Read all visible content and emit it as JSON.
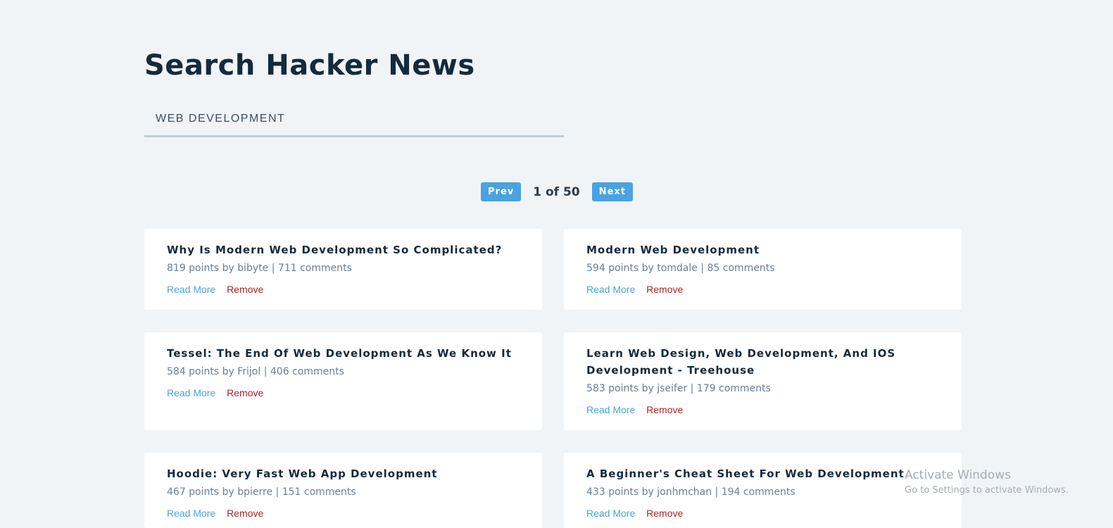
{
  "header": {
    "title": "Search Hacker News"
  },
  "search": {
    "value": "web development",
    "placeholder": ""
  },
  "pagination": {
    "prev_label": "Prev",
    "next_label": "Next",
    "status": "1 of 50"
  },
  "stories": [
    {
      "title": "Why Is Modern Web Development So Complicated?",
      "meta": "819 points by bibyte | 711 comments",
      "read_more": "Read More",
      "remove": "Remove"
    },
    {
      "title": "Modern Web Development",
      "meta": "594 points by tomdale | 85 comments",
      "read_more": "Read More",
      "remove": "Remove"
    },
    {
      "title": "Tessel: The End Of Web Development As We Know It",
      "meta": "584 points by Frijol | 406 comments",
      "read_more": "Read More",
      "remove": "Remove"
    },
    {
      "title": "Learn Web Design, Web Development, And IOS Development - Treehouse",
      "meta": "583 points by jseifer | 179 comments",
      "read_more": "Read More",
      "remove": "Remove"
    },
    {
      "title": "Hoodie: Very Fast Web App Development",
      "meta": "467 points by bpierre | 151 comments",
      "read_more": "Read More",
      "remove": "Remove"
    },
    {
      "title": "A Beginner's Cheat Sheet For Web Development",
      "meta": "433 points by jonhmchan | 194 comments",
      "read_more": "Read More",
      "remove": "Remove"
    }
  ],
  "watermark": {
    "title": "Activate Windows",
    "subtitle": "Go to Settings to activate Windows."
  },
  "colors": {
    "background": "#f1f4f7",
    "accent": "#48a3e0",
    "danger": "#b01f24",
    "heading": "#142a3d"
  }
}
